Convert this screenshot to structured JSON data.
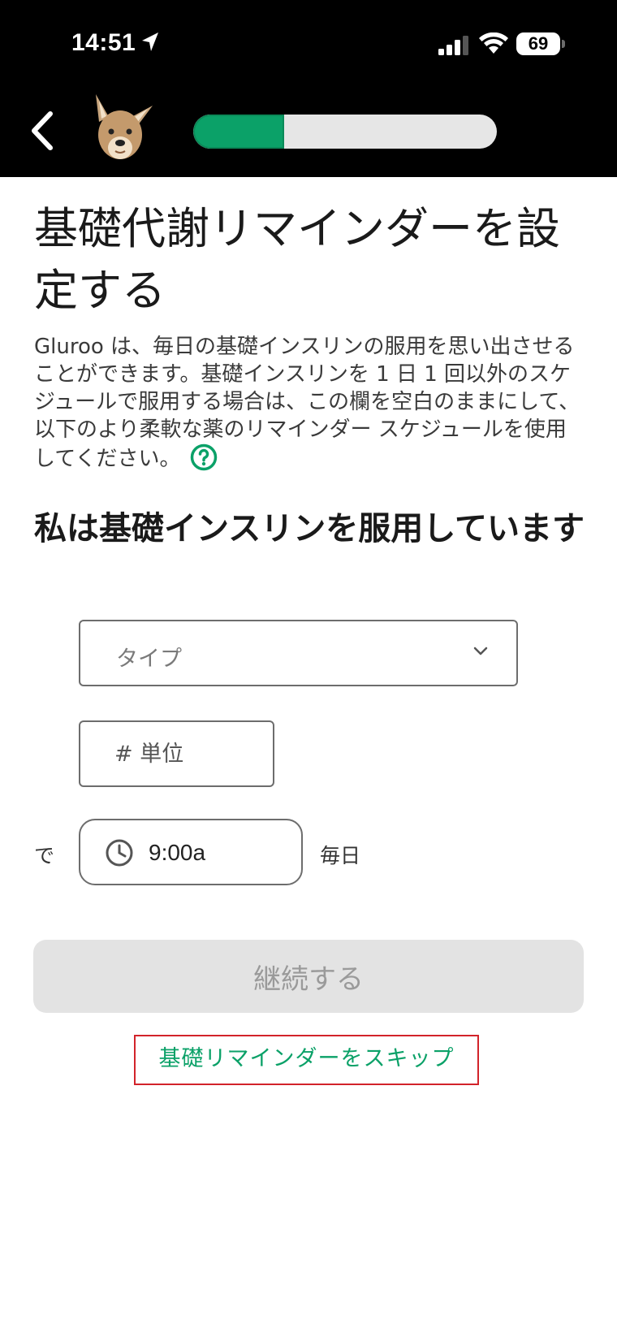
{
  "status_bar": {
    "time": "14:51",
    "battery": "69",
    "location_icon": "location-arrow-icon",
    "signal_icon": "cellular-signal-icon",
    "wifi_icon": "wifi-icon"
  },
  "header": {
    "back_icon": "chevron-left-icon",
    "mascot": "kangaroo-mascot",
    "progress": 0.3
  },
  "main": {
    "title": "基礎代謝リマインダーを設定する",
    "description": "Gluroo は、毎日の基礎インスリンの服用を思い出させることができます。基礎インスリンを 1 日 1 回以外のスケジュールで服用する場合は、この欄を空白のままにして、以下のより柔軟な薬のリマインダー スケジュールを使用してください。",
    "help_icon": "question-circle-icon",
    "section_title": "私は基礎インスリンを服用しています",
    "type_select": {
      "placeholder": "タイプ"
    },
    "units_input": {
      "placeholder": "# 単位"
    },
    "at_label": "で",
    "time_value": "9:00a",
    "daily_label": "毎日",
    "continue_label": "継続する",
    "skip_label": "基礎リマインダーをスキップ"
  },
  "colors": {
    "accent": "#0ba168",
    "button_disabled_bg": "#e3e3e3",
    "highlight_border": "#d2232a"
  }
}
